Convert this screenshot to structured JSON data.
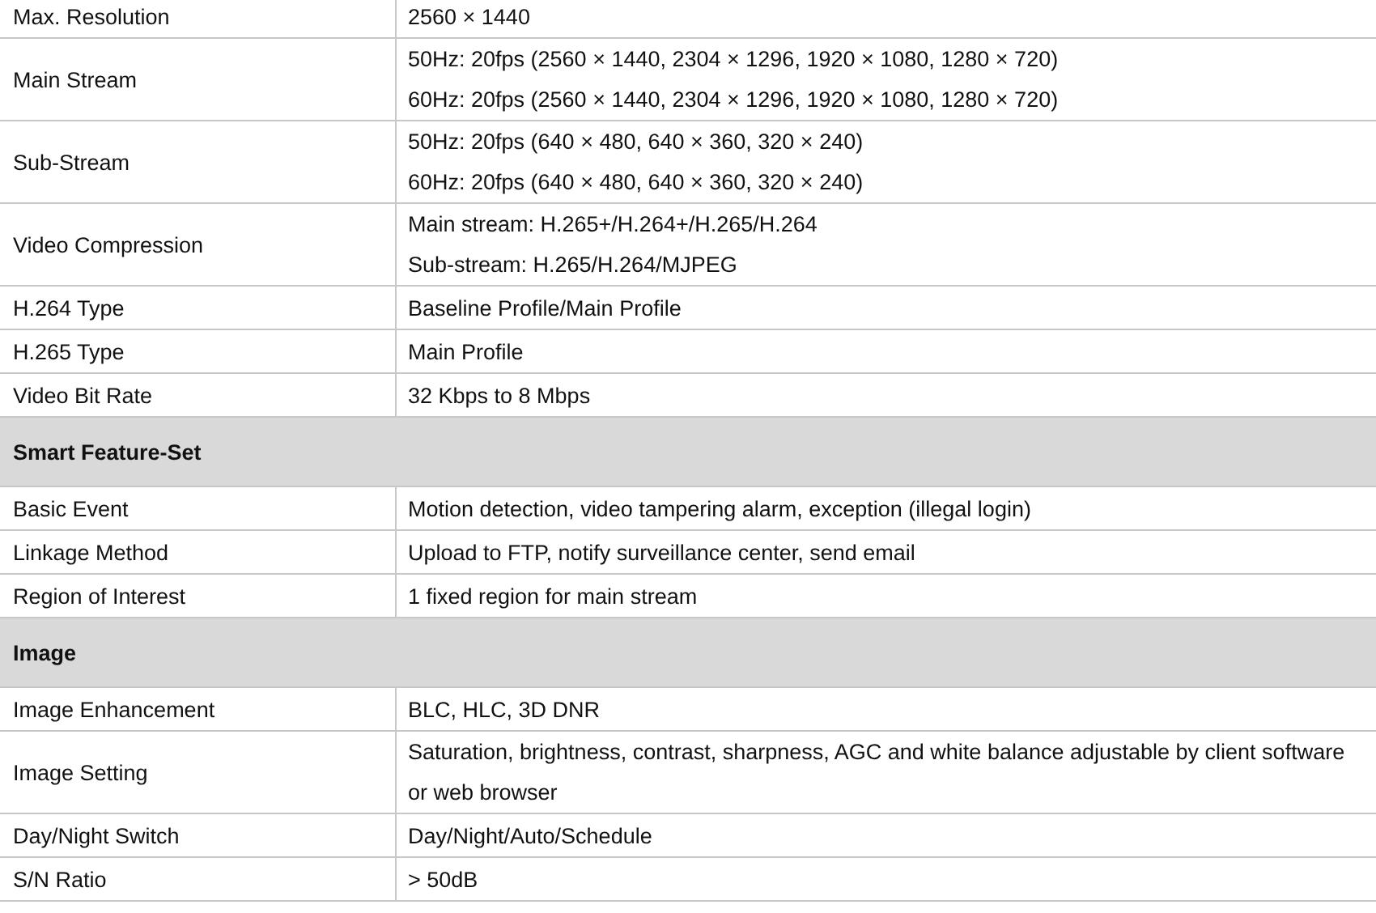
{
  "spec_table": {
    "rows": [
      {
        "kind": "spec",
        "label": "Max. Resolution",
        "values": [
          "2560 × 1440"
        ]
      },
      {
        "kind": "spec",
        "label": "Main Stream",
        "values": [
          "50Hz: 20fps (2560 × 1440, 2304 × 1296, 1920 × 1080, 1280 × 720)",
          "60Hz: 20fps (2560 × 1440, 2304 × 1296, 1920 × 1080, 1280 × 720)"
        ]
      },
      {
        "kind": "spec",
        "label": "Sub-Stream",
        "values": [
          "50Hz: 20fps (640 × 480, 640 × 360, 320 × 240)",
          "60Hz: 20fps (640 × 480, 640 × 360, 320 × 240)"
        ]
      },
      {
        "kind": "spec",
        "label": "Video Compression",
        "values": [
          "Main stream: H.265+/H.264+/H.265/H.264",
          "Sub-stream: H.265/H.264/MJPEG"
        ]
      },
      {
        "kind": "spec",
        "label": "H.264 Type",
        "values": [
          "Baseline Profile/Main Profile"
        ]
      },
      {
        "kind": "spec",
        "label": "H.265 Type",
        "values": [
          "Main Profile"
        ]
      },
      {
        "kind": "spec",
        "label": "Video Bit Rate",
        "values": [
          "32 Kbps to 8 Mbps"
        ]
      },
      {
        "kind": "section",
        "title": "Smart Feature-Set"
      },
      {
        "kind": "spec",
        "label": "Basic Event",
        "values": [
          "Motion detection, video tampering alarm, exception (illegal login)"
        ]
      },
      {
        "kind": "spec",
        "label": "Linkage Method",
        "values": [
          "Upload to FTP, notify surveillance center, send email"
        ]
      },
      {
        "kind": "spec",
        "label": "Region of Interest",
        "values": [
          "1 fixed region for main stream"
        ]
      },
      {
        "kind": "section",
        "title": "Image"
      },
      {
        "kind": "spec",
        "label": "Image Enhancement",
        "values": [
          "BLC, HLC, 3D DNR"
        ]
      },
      {
        "kind": "spec",
        "label": "Image Setting",
        "values": [
          "Saturation, brightness, contrast, sharpness, AGC and white balance adjustable by client software or web browser"
        ]
      },
      {
        "kind": "spec",
        "label": "Day/Night Switch",
        "values": [
          "Day/Night/Auto/Schedule"
        ]
      },
      {
        "kind": "spec",
        "label": "S/N Ratio",
        "values": [
          "> 50dB"
        ]
      }
    ]
  }
}
